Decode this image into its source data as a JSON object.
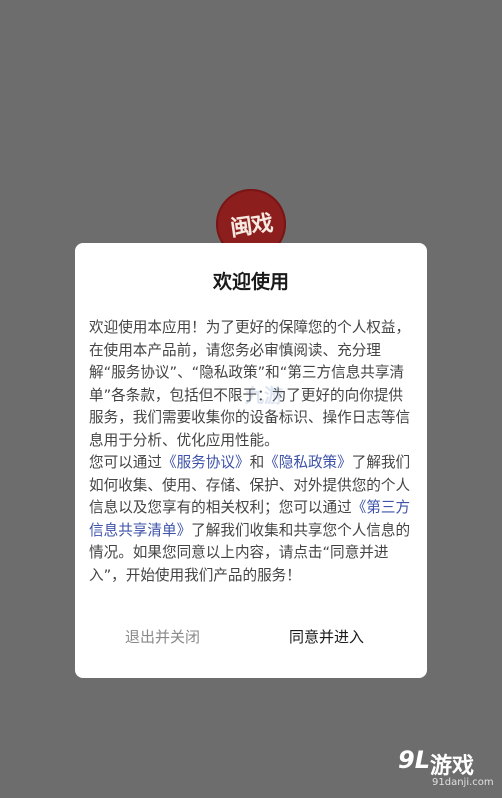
{
  "app": {
    "logo_text": "闽戏"
  },
  "dialog": {
    "title": "欢迎使用",
    "body": {
      "p1": "欢迎使用本应用！为了更好的保障您的个人权益，在使用本产品前，请您务必审慎阅读、充分理解“服务协议”、“隐私政策”和“第三方信息共享清单”各条款，包括但不限于：为了更好的向你提供服务，我们需要收集你的设备标识、操作日志等信息用于分析、优化应用性能。",
      "p2_prefix": "您可以通过",
      "link_service": "《服务协议》",
      "p2_and": "和",
      "link_privacy": "《隐私政策》",
      "p2_mid": "了解我们如何收集、使用、存储、保护、对外提供您的个人信息以及您享有的相关权利；您可以通过",
      "link_thirdparty": "《第三方信息共享清单》",
      "p2_suffix": "了解我们收集和共享您个人信息的情况。如果您同意以上内容，请点击“同意并进入”，开始使用我们产品的服务！"
    },
    "buttons": {
      "exit": "退出并关闭",
      "agree": "同意并进入"
    }
  },
  "watermark": {
    "center": "九游",
    "brand_mark": "9L",
    "brand_name": "游戏",
    "domain": "91danji.com"
  }
}
